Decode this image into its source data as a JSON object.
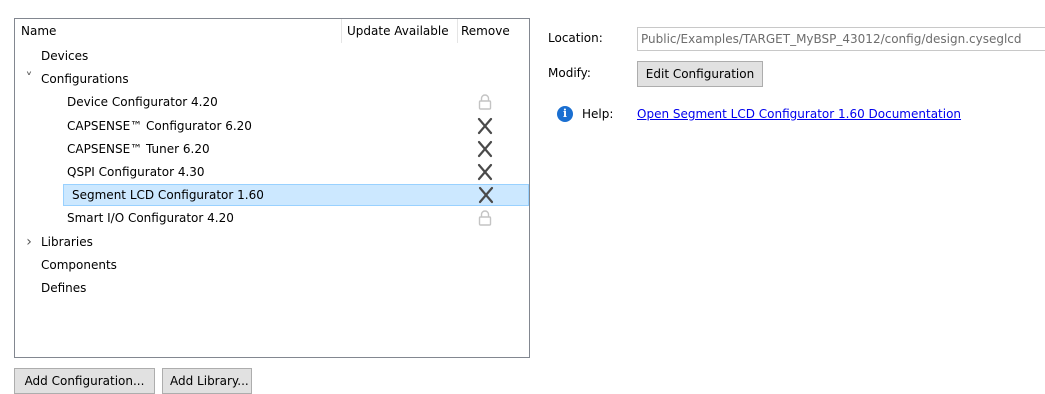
{
  "tree": {
    "columns": {
      "name": "Name",
      "update_available": "Update Available",
      "remove": "Remove"
    },
    "items": [
      {
        "label": "Devices",
        "level": 0,
        "expander": "none",
        "icon": ""
      },
      {
        "label": "Configurations",
        "level": 0,
        "expander": "expanded",
        "icon": ""
      },
      {
        "label": "Device Configurator 4.20",
        "level": 1,
        "expander": "none",
        "icon": "lock-icon"
      },
      {
        "label": "CAPSENSE™ Configurator 6.20",
        "level": 1,
        "expander": "none",
        "icon": "remove-icon"
      },
      {
        "label": "CAPSENSE™ Tuner 6.20",
        "level": 1,
        "expander": "none",
        "icon": "remove-icon"
      },
      {
        "label": "QSPI Configurator 4.30",
        "level": 1,
        "expander": "none",
        "icon": "remove-icon"
      },
      {
        "label": "Segment LCD Configurator 1.60",
        "level": 1,
        "expander": "none",
        "icon": "remove-icon",
        "selected": true
      },
      {
        "label": "Smart I/O Configurator 4.20",
        "level": 1,
        "expander": "none",
        "icon": "lock-icon"
      },
      {
        "label": "Libraries",
        "level": 0,
        "expander": "collapsed",
        "icon": ""
      },
      {
        "label": "Components",
        "level": 0,
        "expander": "none",
        "icon": ""
      },
      {
        "label": "Defines",
        "level": 0,
        "expander": "none",
        "icon": ""
      }
    ]
  },
  "buttons": {
    "add_configuration": "Add Configuration...",
    "add_library": "Add Library..."
  },
  "properties": {
    "location_label": "Location:",
    "location_value": "Public/Examples/TARGET_MyBSP_43012/config/design.cyseglcd",
    "modify_label": "Modify:",
    "edit_configuration": "Edit Configuration",
    "help_label": "Help:",
    "help_link": "Open Segment LCD Configurator 1.60 Documentation"
  },
  "colors": {
    "selection_background": "#cce8ff",
    "selection_border": "#99d1ff",
    "link": "#0000ee",
    "info_icon": "#1a6fd1"
  }
}
